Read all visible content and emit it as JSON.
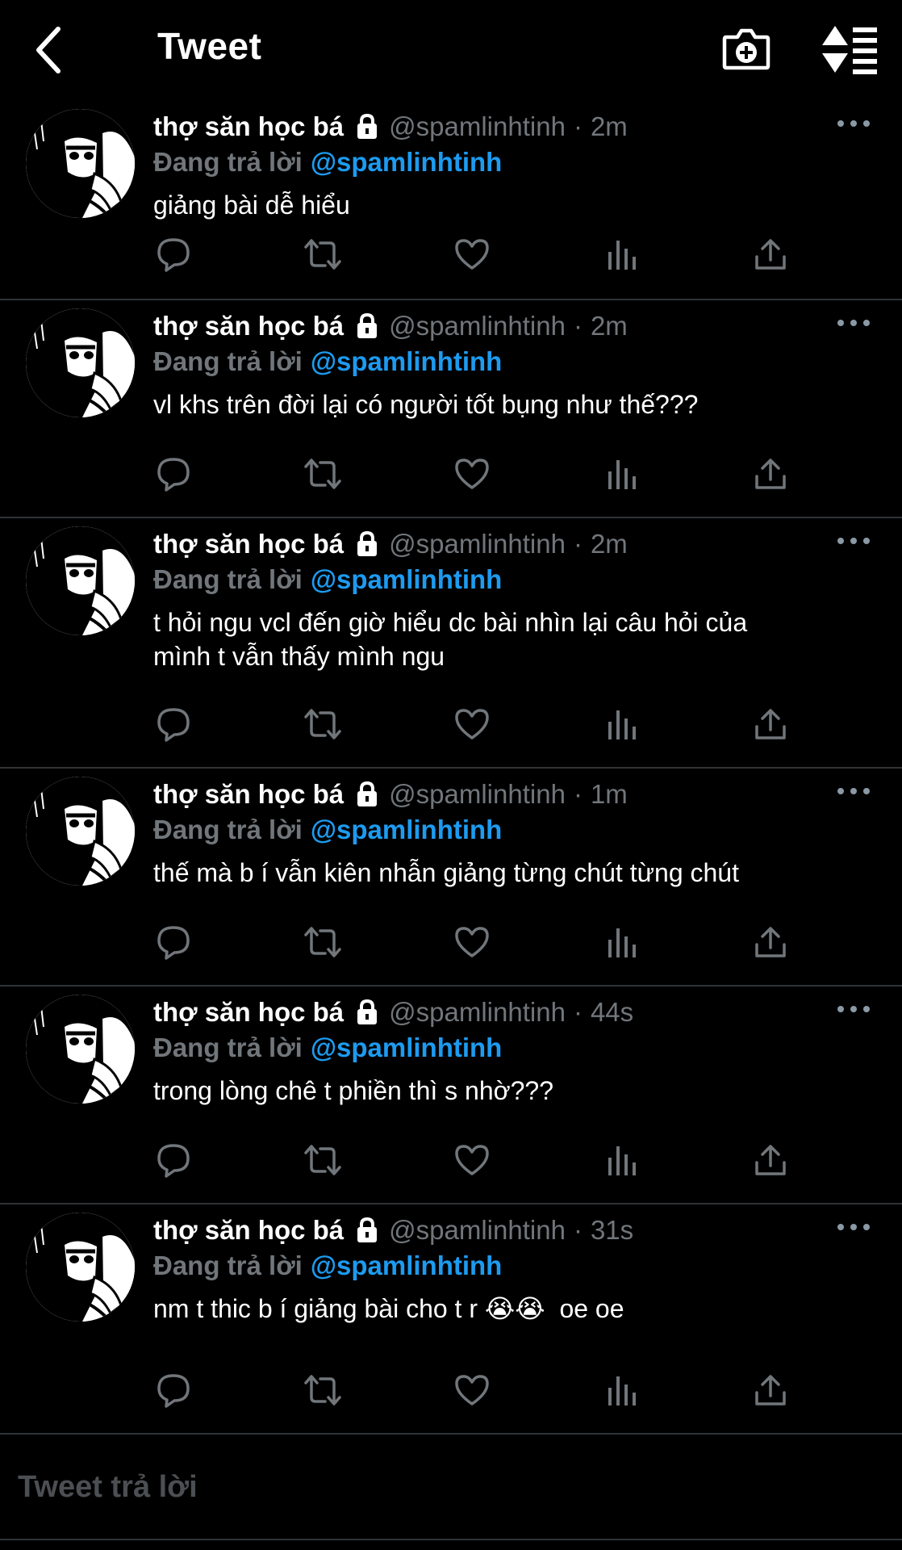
{
  "header": {
    "title": "Tweet",
    "icons": [
      "back-arrow-icon",
      "camera-plus-icon",
      "sort-icon"
    ]
  },
  "colors": {
    "background": "#000000",
    "text": "#ffffff",
    "muted": "#71767b",
    "accent": "#1d9bf0",
    "divider": "#2f3336"
  },
  "tweets": [
    {
      "author": "thợ săn học bá",
      "handle": "@spamlinhtinh",
      "separator": "·",
      "time": "2m",
      "reply_prefix": "Đang trả lời",
      "reply_to": "@spamlinhtinh",
      "text": "giảng bài dễ hiểu"
    },
    {
      "author": "thợ săn học bá",
      "handle": "@spamlinhtinh",
      "separator": "·",
      "time": "2m",
      "reply_prefix": "Đang trả lời",
      "reply_to": "@spamlinhtinh",
      "text": "vl khs trên đời lại có người tốt bụng như thế???"
    },
    {
      "author": "thợ săn học bá",
      "handle": "@spamlinhtinh",
      "separator": "·",
      "time": "2m",
      "reply_prefix": "Đang trả lời",
      "reply_to": "@spamlinhtinh",
      "text": "t hỏi ngu vcl đến giờ hiểu dc bài nhìn lại câu hỏi của\nmình t vẫn thấy mình ngu"
    },
    {
      "author": "thợ săn học bá",
      "handle": "@spamlinhtinh",
      "separator": "·",
      "time": "1m",
      "reply_prefix": "Đang trả lời",
      "reply_to": "@spamlinhtinh",
      "text": "thế mà b í vẫn kiên nhẫn giảng từng chút từng chút"
    },
    {
      "author": "thợ săn học bá",
      "handle": "@spamlinhtinh",
      "separator": "·",
      "time": "44s",
      "reply_prefix": "Đang trả lời",
      "reply_to": "@spamlinhtinh",
      "text": "trong lòng chê t phiền thì s nhờ???"
    },
    {
      "author": "thợ săn học bá",
      "handle": "@spamlinhtinh",
      "separator": "·",
      "time": "31s",
      "reply_prefix": "Đang trả lời",
      "reply_to": "@spamlinhtinh",
      "text": "nm t thic b í giảng bài cho t r 😭😭  oe oe"
    }
  ],
  "tweet_actions": [
    "reply-icon",
    "retweet-icon",
    "like-icon",
    "analytics-icon",
    "share-icon"
  ],
  "composer": {
    "placeholder": "Tweet trả lời"
  }
}
